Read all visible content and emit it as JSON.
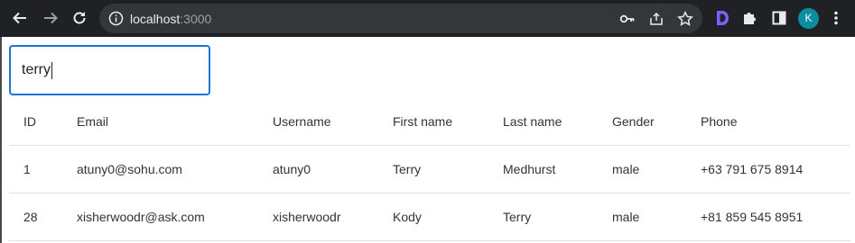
{
  "browser": {
    "url_host": "localhost",
    "url_port": ":3000",
    "profile_initial": "K"
  },
  "search": {
    "value": "terry"
  },
  "table": {
    "headers": [
      "ID",
      "Email",
      "Username",
      "First name",
      "Last name",
      "Gender",
      "Phone"
    ],
    "rows": [
      [
        "1",
        "atuny0@sohu.com",
        "atuny0",
        "Terry",
        "Medhurst",
        "male",
        "+63 791 675 8914"
      ],
      [
        "28",
        "xisherwoodr@ask.com",
        "xisherwoodr",
        "Kody",
        "Terry",
        "male",
        "+81 859 545 8951"
      ]
    ]
  },
  "colors": {
    "chrome_bg": "#202124",
    "omnibox_bg": "#35363a",
    "accent": "#1976d2",
    "avatar": "#0b8fa0",
    "extension_purple": "#7b61ff"
  }
}
